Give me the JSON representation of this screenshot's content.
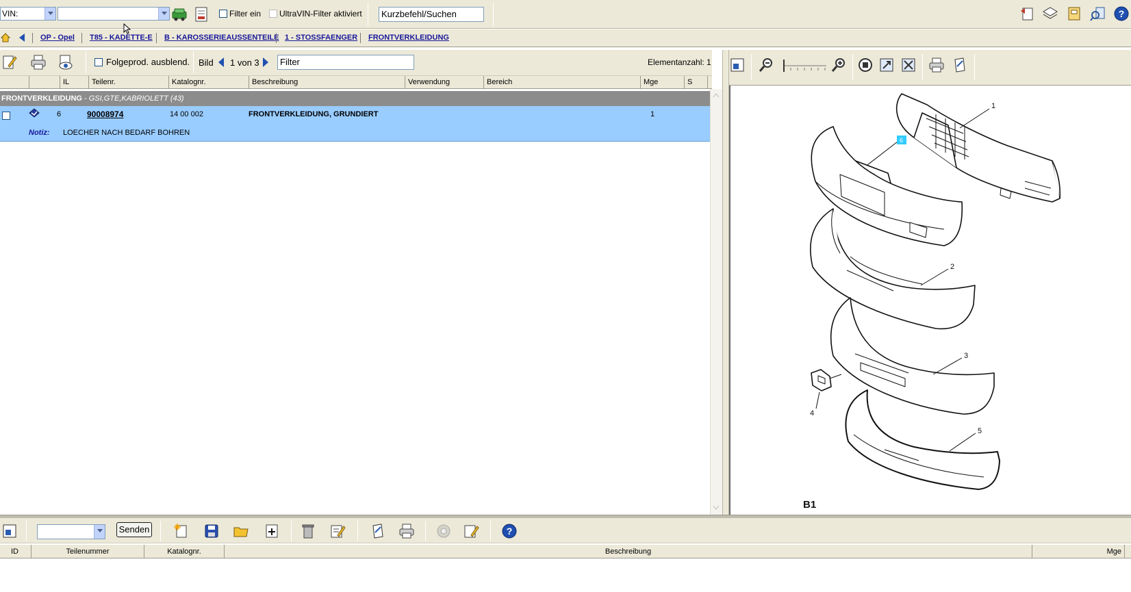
{
  "topbar": {
    "vin_label": "VIN:",
    "vin_value": "",
    "filter_label": "Filter ein",
    "filter_checked": false,
    "ultravin_label": "UltraVIN-Filter aktiviert",
    "ultravin_checked": false,
    "search_value": "Kurzbefehl/Suchen"
  },
  "breadcrumb": {
    "items": [
      "OP - Opel",
      "T85 - KADETTE-E",
      "B - KAROSSERIEAUSSENTEILE",
      "1 - STOSSFAENGER",
      "FRONTVERKLEIDUNG"
    ]
  },
  "left_toolbar": {
    "folgeprod_label": "Folgeprod. ausblend.",
    "bild_label": "Bild",
    "page_indicator": "1 von 3",
    "filter_value": "Filter",
    "element_count": "Elementanzahl: 1"
  },
  "table": {
    "columns": [
      "",
      "",
      "IL",
      "Teilenr.",
      "Katalognr.",
      "Beschreibung",
      "Verwendung",
      "Bereich",
      "Mge",
      "S"
    ],
    "group": {
      "title": "FRONTVERKLEIDUNG",
      "subtitle": " - GSI,GTE,KABRIOLETT (43)"
    },
    "rows": [
      {
        "il": "6",
        "teilenr": "90008974",
        "katalognr": "14 00 002",
        "beschreibung": "FRONTVERKLEIDUNG, GRUNDIERT",
        "verwendung": "",
        "bereich": "",
        "mge": "1",
        "s": "",
        "note_label": "Notiz:",
        "note_text": "LOECHER NACH BEDARF BOHREN"
      }
    ]
  },
  "diagram": {
    "callouts": [
      "1",
      "2",
      "3",
      "4",
      "5",
      "6"
    ],
    "highlighted_callout": "6",
    "label": "B1"
  },
  "bottom": {
    "send_label": "Senden",
    "dropdown_value": "",
    "columns": [
      "ID",
      "Teilenummer",
      "Katalognr.",
      "Beschreibung",
      "Mge"
    ]
  },
  "colors": {
    "toolbar_bg": "#ece9d8",
    "selected_row": "#99ccff",
    "group_row": "#8c8c8c",
    "link": "#17179a",
    "callout_highlight": "#33ccff"
  }
}
